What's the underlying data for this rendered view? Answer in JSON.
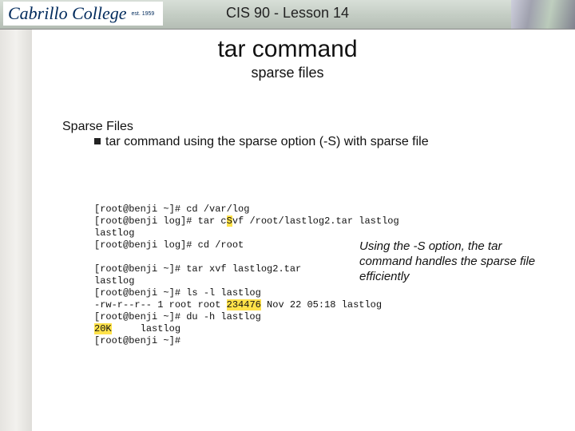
{
  "header": {
    "logo_main": "Cabrillo College",
    "logo_sub": "est. 1959",
    "title": "CIS 90 - Lesson 14"
  },
  "page": {
    "title": "tar command",
    "subtitle": "sparse files"
  },
  "section": {
    "heading": "Sparse Files",
    "bullet": "tar command using the sparse option (-S) with sparse file"
  },
  "term": {
    "l1a": "[root@benji ~]# cd /var/log",
    "l2a": "[root@benji log]# tar c",
    "l2hl": "S",
    "l2b": "vf /root/lastlog2.tar lastlog",
    "l3": "lastlog",
    "l4": "[root@benji log]# cd /root",
    "blank": " ",
    "l5": "[root@benji ~]# tar xvf lastlog2.tar",
    "l6": "lastlog",
    "l7": "[root@benji ~]# ls -l lastlog",
    "l8a": "-rw-r--r-- 1 root root ",
    "l8hl": "234476",
    "l8b": " Nov 22 05:18 lastlog",
    "l9": "[root@benji ~]# du -h lastlog",
    "l10hl": "20K",
    "l10b": "     lastlog",
    "l11": "[root@benji ~]#"
  },
  "annotation": "Using the -S option, the tar command handles the sparse file efficiently"
}
